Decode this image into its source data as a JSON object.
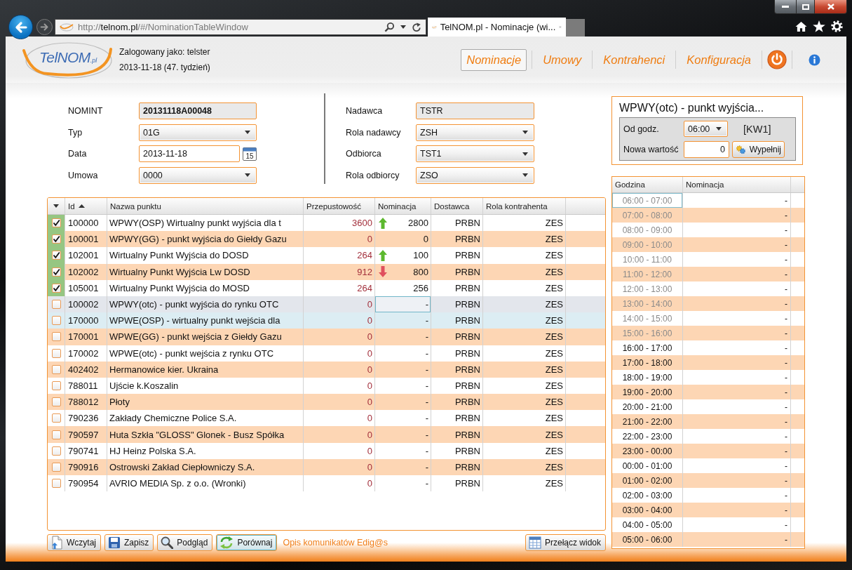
{
  "browser": {
    "url": "http://**telnom.pl**/#/NominationTableWindow",
    "tab_title": "TelNOM.pl - Nominacje (wi..."
  },
  "header": {
    "logo_text": "TelNOM",
    "logo_suffix": ".pl",
    "user_line": "Zalogowany jako: telster",
    "date_line": "2013-11-18 (47. tydzień)"
  },
  "nav": [
    {
      "label": "Nominacje",
      "selected": true
    },
    {
      "label": "Umowy",
      "selected": false
    },
    {
      "label": "Kontrahenci",
      "selected": false
    },
    {
      "label": "Konfiguracja",
      "selected": false
    }
  ],
  "form": {
    "left": [
      {
        "label": "NOMINT",
        "value": "20131118A00048",
        "kind": "readonly",
        "bold": true
      },
      {
        "label": "Typ",
        "value": "01G",
        "kind": "dropdown",
        "bold": false
      },
      {
        "label": "Data",
        "value": "2013-11-18",
        "kind": "date",
        "bold": false
      },
      {
        "label": "Umowa",
        "value": "0000",
        "kind": "dropdown",
        "bold": false
      }
    ],
    "right": [
      {
        "label": "Nadawca",
        "value": "TSTR",
        "kind": "readonly",
        "bold": false
      },
      {
        "label": "Rola nadawcy",
        "value": "ZSH",
        "kind": "dropdown",
        "bold": false
      },
      {
        "label": "Odbiorca",
        "value": "TST1",
        "kind": "dropdown",
        "bold": false
      },
      {
        "label": "Rola odbiorcy",
        "value": "ZSO",
        "kind": "dropdown",
        "bold": false
      }
    ],
    "calendar_label": "15"
  },
  "panel": {
    "title": "WPWY(otc) - punkt wyjścia...",
    "from_label": "Od godz.",
    "from_value": "06:00",
    "code": "[KW1]",
    "value_label": "Nowa wartość",
    "value": "0",
    "fill_button": "Wypełnij"
  },
  "table": {
    "columns": [
      {
        "label": "Id",
        "sorted_ascending": true
      },
      {
        "label": "Nazwa punktu",
        "sorted_ascending": false
      },
      {
        "label": "Przepustowość",
        "sorted_ascending": false
      },
      {
        "label": "Nominacja",
        "sorted_ascending": false
      },
      {
        "label": "Dostawca",
        "sorted_ascending": false
      },
      {
        "label": "Rola kontrahenta",
        "sorted_ascending": false
      }
    ],
    "rows": [
      {
        "id": "100000",
        "name": "WPWY(OSP) Wirtualny punkt wyjścia dla t",
        "capacity": "3600",
        "rising": true,
        "falling": false,
        "nomination": "2800",
        "supplier": "PRBN",
        "role": "ZES",
        "checked": true,
        "selected": false,
        "highlighted": false
      },
      {
        "id": "100001",
        "name": "WPWY(GG) - punkt wyjścia do Giełdy Gazu",
        "capacity": "0",
        "rising": false,
        "falling": false,
        "nomination": "0",
        "supplier": "PRBN",
        "role": "ZES",
        "checked": true,
        "selected": false,
        "highlighted": false
      },
      {
        "id": "102001",
        "name": "Wirtualny Punkt Wyjścia do DOSD",
        "capacity": "264",
        "rising": true,
        "falling": false,
        "nomination": "100",
        "supplier": "PRBN",
        "role": "ZES",
        "checked": true,
        "selected": false,
        "highlighted": false
      },
      {
        "id": "102002",
        "name": "Wirtualny Punkt Wyjścia Lw DOSD",
        "capacity": "912",
        "rising": false,
        "falling": true,
        "nomination": "800",
        "supplier": "PRBN",
        "role": "ZES",
        "checked": true,
        "selected": false,
        "highlighted": false
      },
      {
        "id": "105001",
        "name": "Wirtualny Punkt Wyjścia do MOSD",
        "capacity": "264",
        "rising": false,
        "falling": false,
        "nomination": "256",
        "supplier": "PRBN",
        "role": "ZES",
        "checked": true,
        "selected": false,
        "highlighted": false
      },
      {
        "id": "100002",
        "name": "WPWY(otc) - punkt wyjścia do rynku OTC",
        "capacity": "0",
        "rising": false,
        "falling": false,
        "nomination": "-",
        "supplier": "PRBN",
        "role": "ZES",
        "checked": false,
        "selected": true,
        "highlighted": false
      },
      {
        "id": "170000",
        "name": "WPWE(OSP) - wirtualny punkt wejścia dla",
        "capacity": "0",
        "rising": false,
        "falling": false,
        "nomination": "-",
        "supplier": "PRBN",
        "role": "ZES",
        "checked": false,
        "selected": false,
        "highlighted": true
      },
      {
        "id": "170001",
        "name": "WPWE(GG) - punkt wejścia z Giełdy Gazu",
        "capacity": "0",
        "rising": false,
        "falling": false,
        "nomination": "-",
        "supplier": "PRBN",
        "role": "ZES",
        "checked": false,
        "selected": false,
        "highlighted": false
      },
      {
        "id": "170002",
        "name": "WPWE(otc) - punkt wejścia z rynku OTC",
        "capacity": "0",
        "rising": false,
        "falling": false,
        "nomination": "-",
        "supplier": "PRBN",
        "role": "ZES",
        "checked": false,
        "selected": false,
        "highlighted": false
      },
      {
        "id": "402402",
        "name": "Hermanowice kier. Ukraina",
        "capacity": "0",
        "rising": false,
        "falling": false,
        "nomination": "-",
        "supplier": "PRBN",
        "role": "ZES",
        "checked": false,
        "selected": false,
        "highlighted": false
      },
      {
        "id": "788011",
        "name": "Ujście k.Koszalin",
        "capacity": "0",
        "rising": false,
        "falling": false,
        "nomination": "-",
        "supplier": "PRBN",
        "role": "ZES",
        "checked": false,
        "selected": false,
        "highlighted": false
      },
      {
        "id": "788012",
        "name": "Płoty",
        "capacity": "0",
        "rising": false,
        "falling": false,
        "nomination": "-",
        "supplier": "PRBN",
        "role": "ZES",
        "checked": false,
        "selected": false,
        "highlighted": false
      },
      {
        "id": "790236",
        "name": "Zakłady Chemiczne Police S.A.",
        "capacity": "0",
        "rising": false,
        "falling": false,
        "nomination": "-",
        "supplier": "PRBN",
        "role": "ZES",
        "checked": false,
        "selected": false,
        "highlighted": false
      },
      {
        "id": "790597",
        "name": "Huta Szkła \"GLOSS\" Glonek - Busz Spółka",
        "capacity": "0",
        "rising": false,
        "falling": false,
        "nomination": "-",
        "supplier": "PRBN",
        "role": "ZES",
        "checked": false,
        "selected": false,
        "highlighted": false
      },
      {
        "id": "790741",
        "name": "HJ Heinz Polska S.A.",
        "capacity": "0",
        "rising": false,
        "falling": false,
        "nomination": "-",
        "supplier": "PRBN",
        "role": "ZES",
        "checked": false,
        "selected": false,
        "highlighted": false
      },
      {
        "id": "790916",
        "name": "Ostrowski Zakład Ciepłowniczy S.A.",
        "capacity": "0",
        "rising": false,
        "falling": false,
        "nomination": "-",
        "supplier": "PRBN",
        "role": "ZES",
        "checked": false,
        "selected": false,
        "highlighted": false
      },
      {
        "id": "790954",
        "name": "AVRIO MEDIA Sp. z o.o. (Wronki)",
        "capacity": "0",
        "rising": false,
        "falling": false,
        "nomination": "-",
        "supplier": "PRBN",
        "role": "ZES",
        "checked": false,
        "selected": false,
        "highlighted": false
      }
    ]
  },
  "actions": [
    {
      "kind": "load",
      "label": "Wczytaj",
      "focused": false
    },
    {
      "kind": "save",
      "label": "Zapisz",
      "focused": false
    },
    {
      "kind": "preview",
      "label": "Podgląd",
      "focused": false
    },
    {
      "kind": "compare",
      "label": "Porównaj",
      "focused": true
    }
  ],
  "link": "Opis komunikatów Edig@s",
  "view_button": "Przełącz widok",
  "hours": {
    "columns": [
      "Godzina",
      "Nominacja"
    ],
    "rows": [
      {
        "hour": "06:00 - 07:00",
        "value": "-",
        "disabled": true,
        "selected": true
      },
      {
        "hour": "07:00 - 08:00",
        "value": "-",
        "disabled": true,
        "selected": false
      },
      {
        "hour": "08:00 - 09:00",
        "value": "-",
        "disabled": true,
        "selected": false
      },
      {
        "hour": "09:00 - 10:00",
        "value": "-",
        "disabled": true,
        "selected": false
      },
      {
        "hour": "10:00 - 11:00",
        "value": "-",
        "disabled": true,
        "selected": false
      },
      {
        "hour": "11:00 - 12:00",
        "value": "-",
        "disabled": true,
        "selected": false
      },
      {
        "hour": "12:00 - 13:00",
        "value": "-",
        "disabled": true,
        "selected": false
      },
      {
        "hour": "13:00 - 14:00",
        "value": "-",
        "disabled": true,
        "selected": false
      },
      {
        "hour": "14:00 - 15:00",
        "value": "-",
        "disabled": true,
        "selected": false
      },
      {
        "hour": "15:00 - 16:00",
        "value": "-",
        "disabled": true,
        "selected": false
      },
      {
        "hour": "16:00 - 17:00",
        "value": "-",
        "disabled": false,
        "selected": false
      },
      {
        "hour": "17:00 - 18:00",
        "value": "-",
        "disabled": false,
        "selected": false
      },
      {
        "hour": "18:00 - 19:00",
        "value": "-",
        "disabled": false,
        "selected": false
      },
      {
        "hour": "19:00 - 20:00",
        "value": "-",
        "disabled": false,
        "selected": false
      },
      {
        "hour": "20:00 - 21:00",
        "value": "-",
        "disabled": false,
        "selected": false
      },
      {
        "hour": "21:00 - 22:00",
        "value": "-",
        "disabled": false,
        "selected": false
      },
      {
        "hour": "22:00 - 23:00",
        "value": "-",
        "disabled": false,
        "selected": false
      },
      {
        "hour": "23:00 - 00:00",
        "value": "-",
        "disabled": false,
        "selected": false
      },
      {
        "hour": "00:00 - 01:00",
        "value": "-",
        "disabled": false,
        "selected": false
      },
      {
        "hour": "01:00 - 02:00",
        "value": "-",
        "disabled": false,
        "selected": false
      },
      {
        "hour": "02:00 - 03:00",
        "value": "-",
        "disabled": false,
        "selected": false
      },
      {
        "hour": "03:00 - 04:00",
        "value": "-",
        "disabled": false,
        "selected": false
      },
      {
        "hour": "04:00 - 05:00",
        "value": "-",
        "disabled": false,
        "selected": false
      },
      {
        "hour": "05:00 - 06:00",
        "value": "-",
        "disabled": false,
        "selected": false
      }
    ]
  }
}
